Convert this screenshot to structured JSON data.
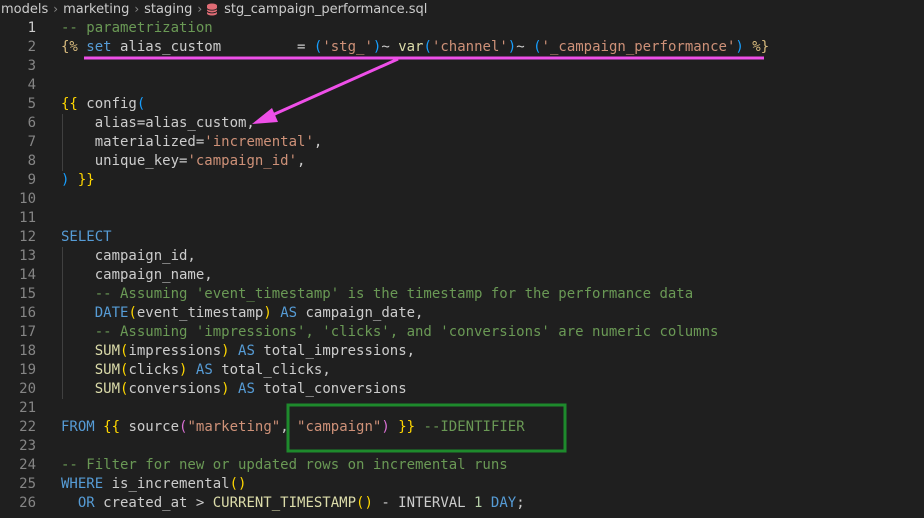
{
  "breadcrumb": {
    "items": [
      "models",
      "marketing",
      "staging",
      "stg_campaign_performance.sql"
    ]
  },
  "editor": {
    "active_line": 1,
    "lines": [
      {
        "n": "1",
        "tokens": [
          {
            "t": "-- parametrization",
            "c": "cm"
          }
        ]
      },
      {
        "n": "2",
        "tokens": [
          {
            "t": "{%",
            "c": "jin"
          },
          {
            "t": " "
          },
          {
            "t": "set",
            "c": "kw"
          },
          {
            "t": " alias_custom         = "
          },
          {
            "t": "(",
            "c": "br3"
          },
          {
            "t": "'stg_'",
            "c": "str"
          },
          {
            "t": ")",
            "c": "br3"
          },
          {
            "t": "~ "
          },
          {
            "t": "var",
            "c": "fn"
          },
          {
            "t": "(",
            "c": "br3"
          },
          {
            "t": "'channel'",
            "c": "str"
          },
          {
            "t": ")",
            "c": "br3"
          },
          {
            "t": "~ "
          },
          {
            "t": "(",
            "c": "br3"
          },
          {
            "t": "'_campaign_performance'",
            "c": "str"
          },
          {
            "t": ")",
            "c": "br3"
          },
          {
            "t": " "
          },
          {
            "t": "%}",
            "c": "jin"
          }
        ]
      },
      {
        "n": "3",
        "tokens": []
      },
      {
        "n": "4",
        "tokens": []
      },
      {
        "n": "5",
        "tokens": [
          {
            "t": "{{",
            "c": "br1"
          },
          {
            "t": " config"
          },
          {
            "t": "(",
            "c": "br3"
          }
        ]
      },
      {
        "n": "6",
        "tokens": [
          {
            "t": "    alias=alias_custom,"
          }
        ]
      },
      {
        "n": "7",
        "tokens": [
          {
            "t": "    materialized="
          },
          {
            "t": "'incremental'",
            "c": "str"
          },
          {
            "t": ","
          }
        ]
      },
      {
        "n": "8",
        "tokens": [
          {
            "t": "    unique_key="
          },
          {
            "t": "'campaign_id'",
            "c": "str"
          },
          {
            "t": ","
          }
        ]
      },
      {
        "n": "9",
        "tokens": [
          {
            "t": ")",
            "c": "br3"
          },
          {
            "t": " "
          },
          {
            "t": "}}",
            "c": "br1"
          }
        ]
      },
      {
        "n": "10",
        "tokens": []
      },
      {
        "n": "11",
        "tokens": []
      },
      {
        "n": "12",
        "tokens": [
          {
            "t": "SELECT",
            "c": "kw"
          }
        ]
      },
      {
        "n": "13",
        "tokens": [
          {
            "t": "    campaign_id,"
          }
        ]
      },
      {
        "n": "14",
        "tokens": [
          {
            "t": "    campaign_name,"
          }
        ]
      },
      {
        "n": "15",
        "tokens": [
          {
            "t": "    -- Assuming 'event_timestamp' is the timestamp for the performance data",
            "c": "cm"
          }
        ]
      },
      {
        "n": "16",
        "tokens": [
          {
            "t": "    "
          },
          {
            "t": "DATE",
            "c": "kw"
          },
          {
            "t": "(",
            "c": "br1"
          },
          {
            "t": "event_timestamp"
          },
          {
            "t": ")",
            "c": "br1"
          },
          {
            "t": " "
          },
          {
            "t": "AS",
            "c": "kw"
          },
          {
            "t": " campaign_date,"
          }
        ]
      },
      {
        "n": "17",
        "tokens": [
          {
            "t": "    -- Assuming 'impressions', 'clicks', and 'conversions' are numeric columns",
            "c": "cm"
          }
        ]
      },
      {
        "n": "18",
        "tokens": [
          {
            "t": "    "
          },
          {
            "t": "SUM",
            "c": "fn"
          },
          {
            "t": "(",
            "c": "br1"
          },
          {
            "t": "impressions"
          },
          {
            "t": ")",
            "c": "br1"
          },
          {
            "t": " "
          },
          {
            "t": "AS",
            "c": "kw"
          },
          {
            "t": " total_impressions,"
          }
        ]
      },
      {
        "n": "19",
        "tokens": [
          {
            "t": "    "
          },
          {
            "t": "SUM",
            "c": "fn"
          },
          {
            "t": "(",
            "c": "br1"
          },
          {
            "t": "clicks"
          },
          {
            "t": ")",
            "c": "br1"
          },
          {
            "t": " "
          },
          {
            "t": "AS",
            "c": "kw"
          },
          {
            "t": " total_clicks,"
          }
        ]
      },
      {
        "n": "20",
        "tokens": [
          {
            "t": "    "
          },
          {
            "t": "SUM",
            "c": "fn"
          },
          {
            "t": "(",
            "c": "br1"
          },
          {
            "t": "conversions"
          },
          {
            "t": ")",
            "c": "br1"
          },
          {
            "t": " "
          },
          {
            "t": "AS",
            "c": "kw"
          },
          {
            "t": " total_conversions"
          }
        ]
      },
      {
        "n": "21",
        "tokens": []
      },
      {
        "n": "22",
        "tokens": [
          {
            "t": "FROM",
            "c": "kw"
          },
          {
            "t": " "
          },
          {
            "t": "{{",
            "c": "br1"
          },
          {
            "t": " source"
          },
          {
            "t": "(",
            "c": "br2"
          },
          {
            "t": "\"marketing\"",
            "c": "str"
          },
          {
            "t": ", "
          },
          {
            "t": "\"campaign\"",
            "c": "str"
          },
          {
            "t": ")",
            "c": "br2"
          },
          {
            "t": " "
          },
          {
            "t": "}}",
            "c": "br1"
          },
          {
            "t": " "
          },
          {
            "t": "--IDENTIFIER",
            "c": "cm"
          }
        ]
      },
      {
        "n": "23",
        "tokens": []
      },
      {
        "n": "24",
        "tokens": [
          {
            "t": "-- Filter for new or updated rows on incremental runs",
            "c": "cm"
          }
        ]
      },
      {
        "n": "25",
        "tokens": [
          {
            "t": "WHERE",
            "c": "kw"
          },
          {
            "t": " is_incremental"
          },
          {
            "t": "()",
            "c": "br1"
          }
        ]
      },
      {
        "n": "26",
        "tokens": [
          {
            "t": "  "
          },
          {
            "t": "OR",
            "c": "kw"
          },
          {
            "t": " created_at > "
          },
          {
            "t": "CURRENT_TIMESTAMP",
            "c": "fn"
          },
          {
            "t": "()",
            "c": "br1"
          },
          {
            "t": " - INTERVAL "
          },
          {
            "t": "1",
            "c": "num"
          },
          {
            "t": " "
          },
          {
            "t": "DAY",
            "c": "kw"
          },
          {
            "t": ";"
          }
        ]
      }
    ]
  },
  "colors": {
    "background": "#1f1f1f",
    "annotation_arrow": "#ee4fe8",
    "annotation_box": "#1e8a2c"
  }
}
